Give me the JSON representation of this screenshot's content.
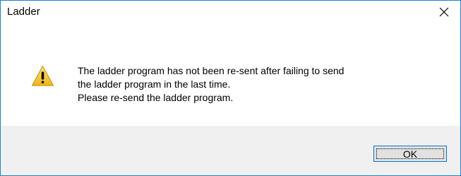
{
  "window": {
    "title": "Ladder",
    "close_icon": "close-icon"
  },
  "message": {
    "icon": "warning-icon",
    "lines": [
      "The ladder program has not been re-sent after failing to send",
      "the ladder program in the last time.",
      "Please re-send the ladder program."
    ]
  },
  "buttons": {
    "ok_label": "OK"
  },
  "colors": {
    "border": "#1883d7",
    "footer_bg": "#f0f0f0",
    "button_bg": "#e1e1e1",
    "button_border": "#0078d7",
    "warning_fill": "#f6c42d"
  }
}
